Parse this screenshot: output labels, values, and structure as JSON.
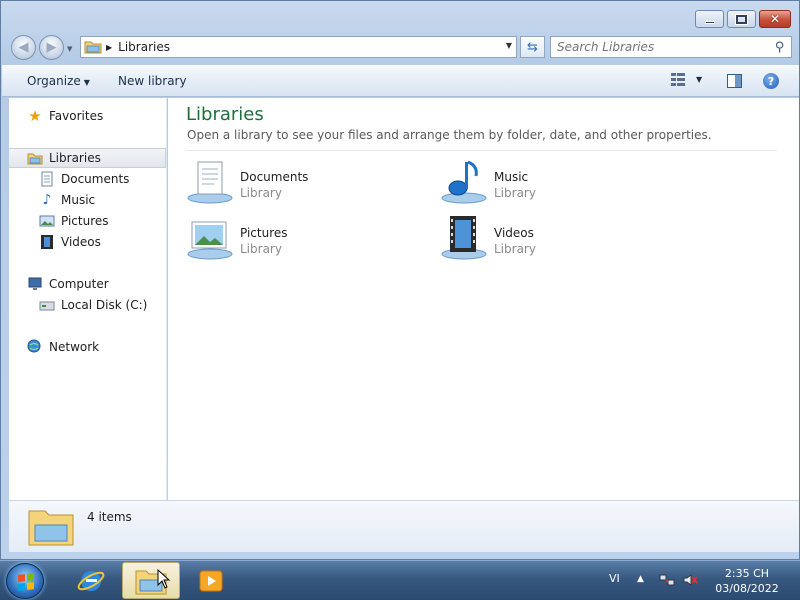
{
  "window": {
    "address": {
      "current": "Libraries"
    },
    "search": {
      "placeholder": "Search Libraries"
    }
  },
  "toolbar": {
    "organize_label": "Organize",
    "new_library_label": "New library"
  },
  "sidebar": {
    "favorites": "Favorites",
    "libraries": "Libraries",
    "library_items": [
      "Documents",
      "Music",
      "Pictures",
      "Videos"
    ],
    "computer": "Computer",
    "local_disk": "Local Disk (C:)",
    "network": "Network"
  },
  "main": {
    "title": "Libraries",
    "subtitle": "Open a library to see your files and arrange them by folder, date, and other properties.",
    "items": [
      {
        "name": "Documents",
        "kind": "Library",
        "icon": "documents-library-icon"
      },
      {
        "name": "Music",
        "kind": "Library",
        "icon": "music-library-icon"
      },
      {
        "name": "Pictures",
        "kind": "Library",
        "icon": "pictures-library-icon"
      },
      {
        "name": "Videos",
        "kind": "Library",
        "icon": "videos-library-icon"
      }
    ]
  },
  "details": {
    "count": "4 items"
  },
  "taskbar": {
    "language": "VI",
    "time": "2:35 CH",
    "date": "03/08/2022"
  },
  "colors": {
    "title_green": "#1e6f3a",
    "taskbar": "#37587f",
    "close_red": "#c8503a"
  }
}
